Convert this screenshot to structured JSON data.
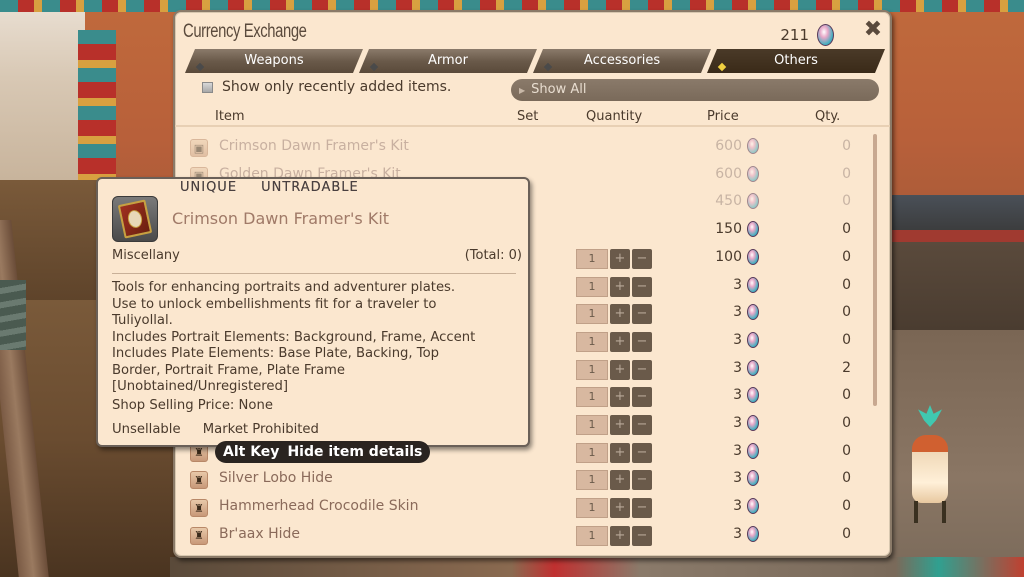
{
  "window": {
    "title": "Currency Exchange",
    "currency_amount": "211",
    "currency_icon": "gem-icon",
    "close_icon": "close-icon"
  },
  "tabs": [
    {
      "label": "Weapons",
      "active": false
    },
    {
      "label": "Armor",
      "active": false
    },
    {
      "label": "Accessories",
      "active": false
    },
    {
      "label": "Others",
      "active": true
    }
  ],
  "filter": {
    "checkbox_label": "Show only recently added items.",
    "checked": false,
    "dropdown_value": "Show All"
  },
  "columns": {
    "item": "Item",
    "set": "Set",
    "quantity": "Quantity",
    "price": "Price",
    "owned": "Qty."
  },
  "items": [
    {
      "name": "Crimson Dawn Framer's Kit",
      "price": "600",
      "owned": "0",
      "dim": true,
      "stepper": false,
      "icon": "chest-icon"
    },
    {
      "name": "Golden Dawn Framer's Kit",
      "price": "600",
      "owned": "0",
      "dim": true,
      "stepper": false,
      "icon": "chest-icon"
    },
    {
      "name": "",
      "price": "450",
      "owned": "0",
      "dim": true,
      "stepper": false,
      "icon": "chest-icon"
    },
    {
      "name": "",
      "price": "150",
      "owned": "0",
      "dim": false,
      "stepper": false,
      "icon": "chest-icon"
    },
    {
      "name": "",
      "price": "100",
      "owned": "0",
      "dim": false,
      "stepper": true,
      "qty": "1",
      "icon": "chest-icon"
    },
    {
      "name": "",
      "price": "3",
      "owned": "0",
      "dim": false,
      "stepper": true,
      "qty": "1",
      "icon": "hide-icon"
    },
    {
      "name": "",
      "price": "3",
      "owned": "0",
      "dim": false,
      "stepper": true,
      "qty": "1",
      "icon": "hide-icon"
    },
    {
      "name": "",
      "price": "3",
      "owned": "0",
      "dim": false,
      "stepper": true,
      "qty": "1",
      "icon": "hide-icon"
    },
    {
      "name": "",
      "price": "3",
      "owned": "2",
      "dim": false,
      "stepper": true,
      "qty": "1",
      "icon": "hide-icon"
    },
    {
      "name": "",
      "price": "3",
      "owned": "0",
      "dim": false,
      "stepper": true,
      "qty": "1",
      "icon": "hide-icon"
    },
    {
      "name": "",
      "price": "3",
      "owned": "0",
      "dim": false,
      "stepper": true,
      "qty": "1",
      "icon": "hide-icon"
    },
    {
      "name": "",
      "price": "3",
      "owned": "0",
      "dim": false,
      "stepper": true,
      "qty": "1",
      "icon": "hide-icon"
    },
    {
      "name": "Silver Lobo Hide",
      "price": "3",
      "owned": "0",
      "dim": false,
      "stepper": true,
      "qty": "1",
      "icon": "hide-icon"
    },
    {
      "name": "Hammerhead Crocodile Skin",
      "price": "3",
      "owned": "0",
      "dim": false,
      "stepper": true,
      "qty": "1",
      "icon": "hide-icon"
    },
    {
      "name": "Br'aax Hide",
      "price": "3",
      "owned": "0",
      "dim": false,
      "stepper": true,
      "qty": "1",
      "icon": "hide-icon"
    }
  ],
  "stepper": {
    "plus": "+",
    "minus": "−"
  },
  "tooltip": {
    "tags": [
      "UNIQUE",
      "UNTRADABLE"
    ],
    "name": "Crimson Dawn Framer's Kit",
    "category": "Miscellany",
    "total": "(Total: 0)",
    "description_lines": [
      "Tools for enhancing portraits and adventurer plates.",
      "Use to unlock embellishments fit for a traveler to",
      "Tuliyollal.",
      "Includes Portrait Elements: Background, Frame, Accent",
      "Includes Plate Elements: Base Plate, Backing, Top",
      "Border, Portrait Frame, Plate Frame",
      "[Unobtained/Unregistered]"
    ],
    "shop_price": "Shop Selling Price: None",
    "flags": [
      "Unsellable",
      "Market Prohibited"
    ]
  },
  "hint": {
    "key": "Alt Key",
    "action": "Hide item details"
  }
}
